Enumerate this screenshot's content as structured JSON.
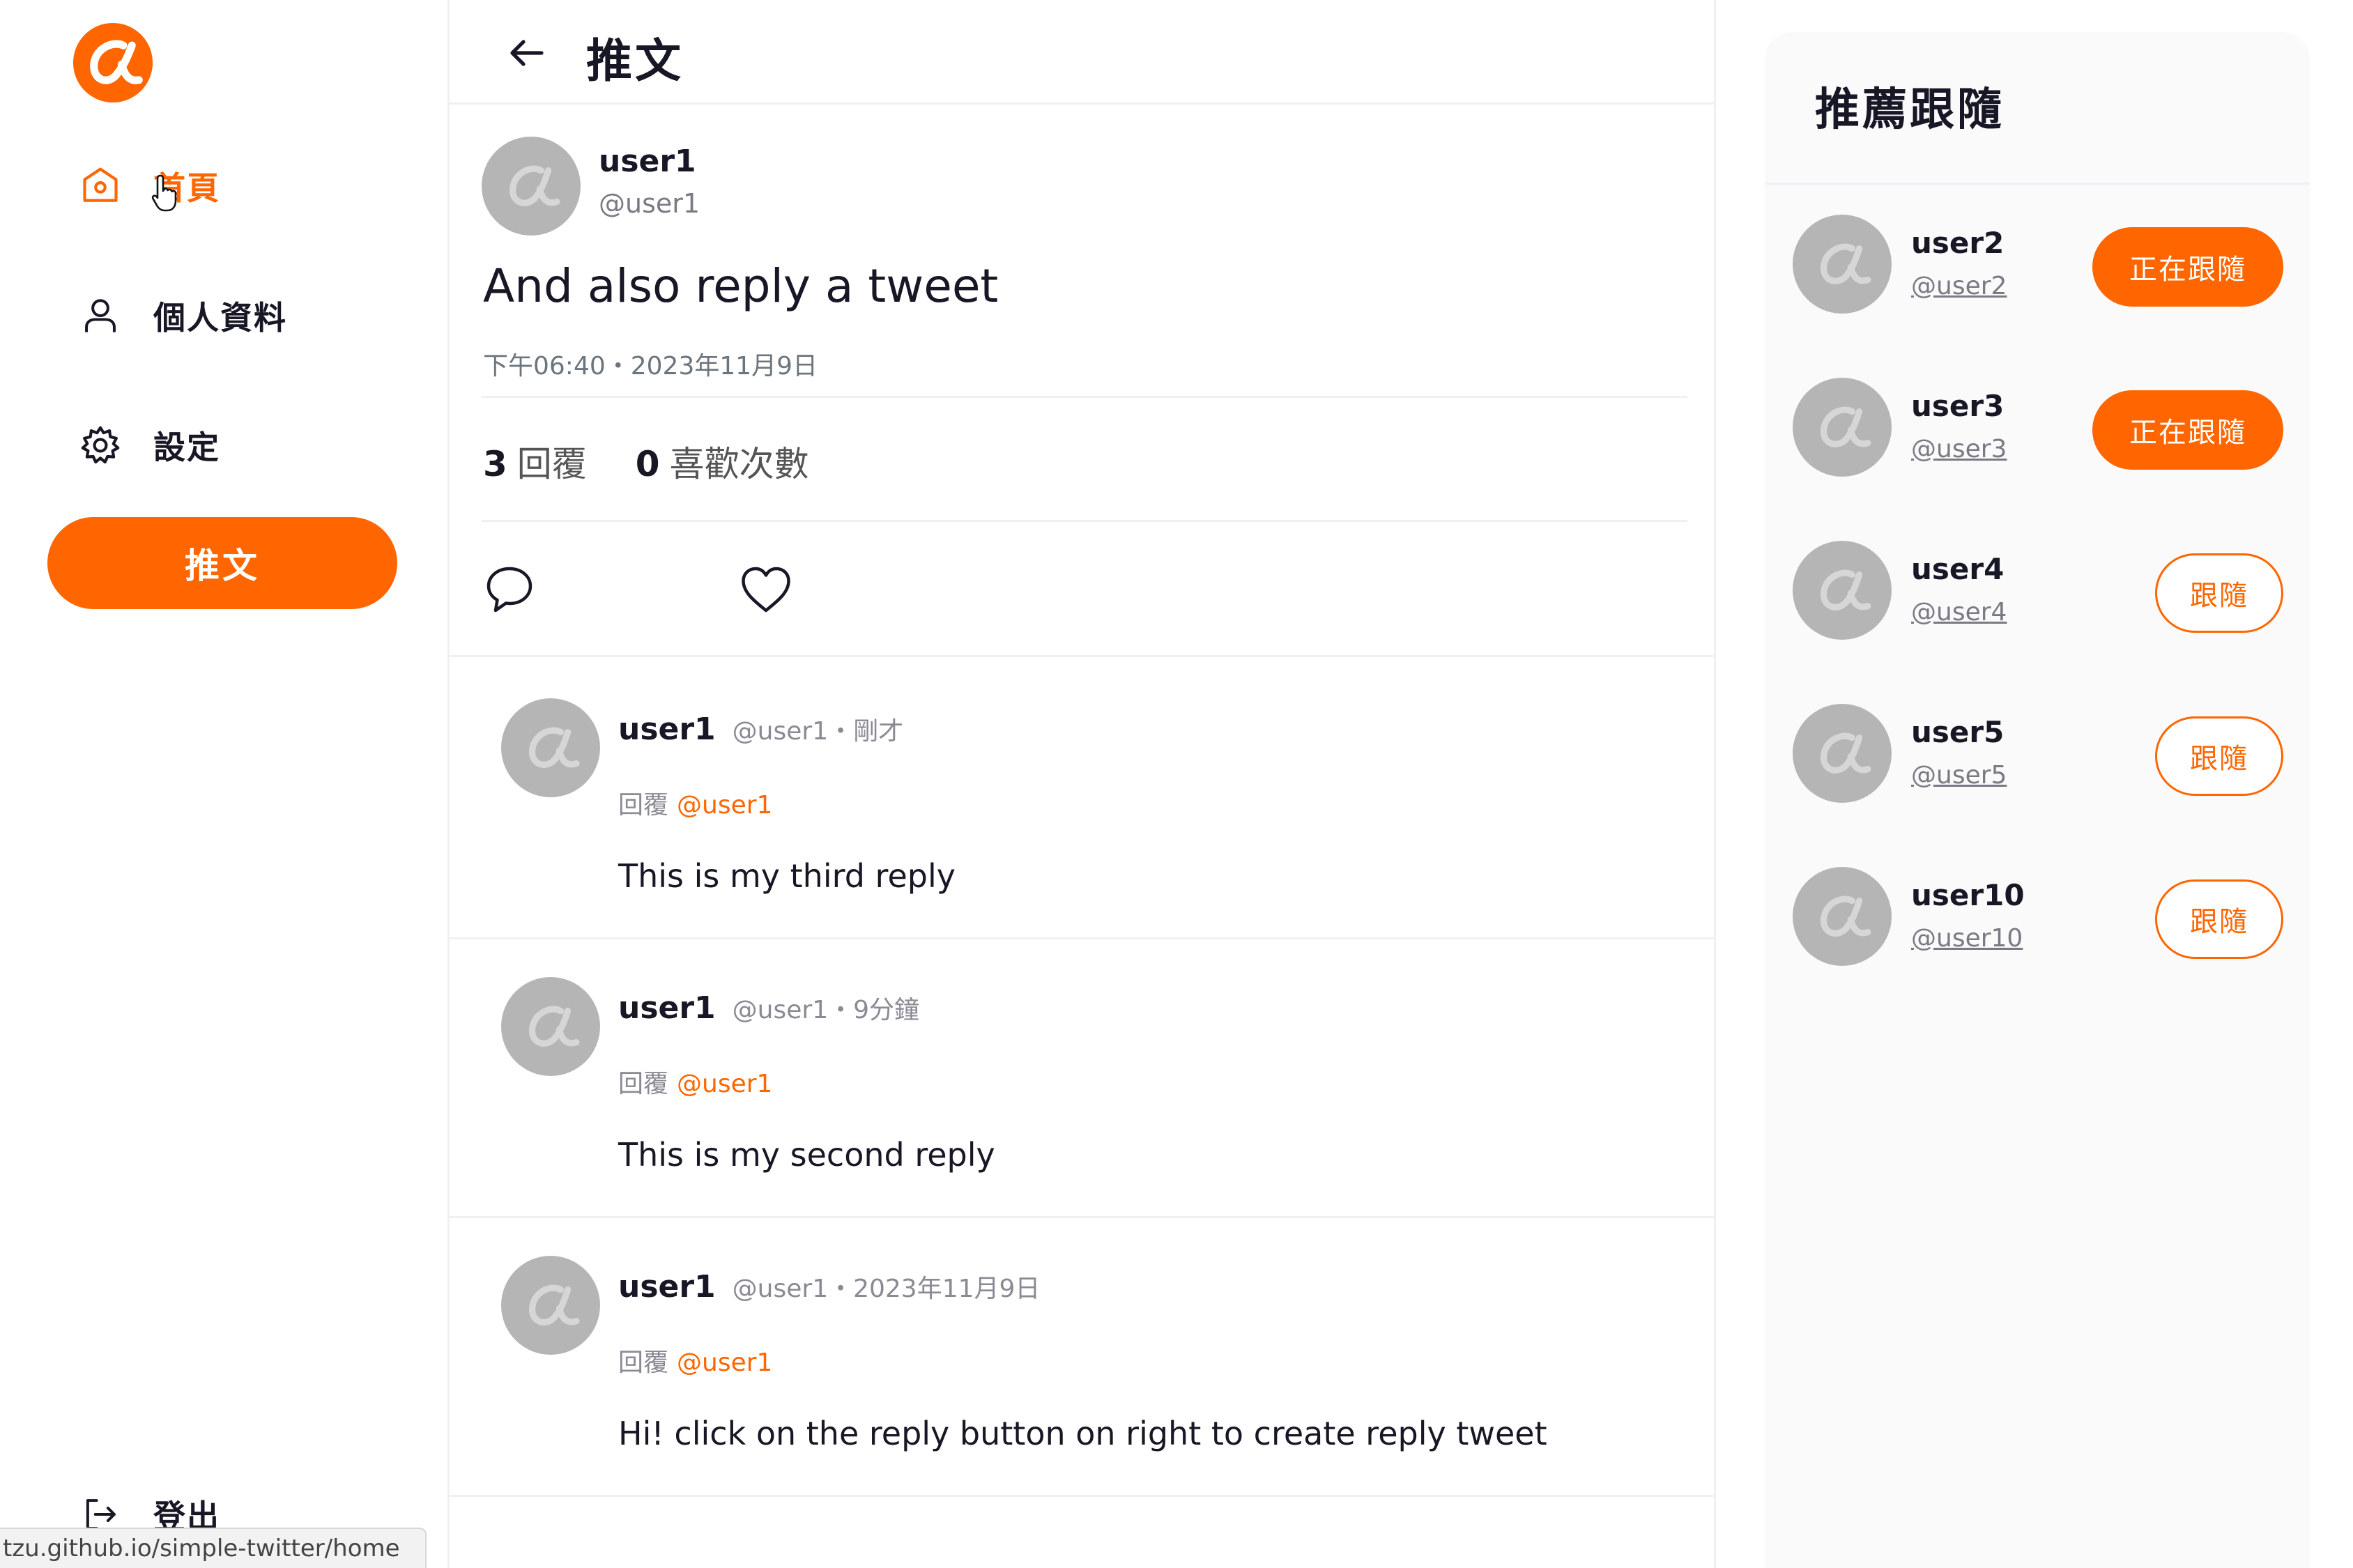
{
  "colors": {
    "brand": "#ff6600",
    "avatar_bg": "#b5b5b5",
    "text": "#171725",
    "muted": "#8a8a94"
  },
  "sidebar": {
    "items": [
      {
        "label": "首頁",
        "icon": "home-icon",
        "active": true
      },
      {
        "label": "個人資料",
        "icon": "user-icon",
        "active": false
      },
      {
        "label": "設定",
        "icon": "gear-icon",
        "active": false
      }
    ],
    "tweet_button": "推文",
    "logout_label": "登出"
  },
  "status_bar": {
    "url": "tzu.github.io/simple-twitter/home"
  },
  "header": {
    "title": "推文"
  },
  "tweet": {
    "name": "user1",
    "handle": "@user1",
    "content": "And also reply a tweet",
    "time": "下午06:40・2023年11月9日",
    "reply_count": "3",
    "reply_label": "回覆",
    "like_count": "0",
    "like_label": "喜歡次數"
  },
  "replies": [
    {
      "name": "user1",
      "meta": "@user1・剛才",
      "reply_to_label": "回覆",
      "reply_to": "@user1",
      "text": "This is my third reply"
    },
    {
      "name": "user1",
      "meta": "@user1・9分鐘",
      "reply_to_label": "回覆",
      "reply_to": "@user1",
      "text": "This is my second reply"
    },
    {
      "name": "user1",
      "meta": "@user1・2023年11月9日",
      "reply_to_label": "回覆",
      "reply_to": "@user1",
      "text": "Hi! click on the reply button on right to create reply tweet"
    }
  ],
  "suggestions": {
    "title": "推薦跟隨",
    "users": [
      {
        "name": "user2",
        "handle": "@user2",
        "button": "正在跟隨",
        "following": true
      },
      {
        "name": "user3",
        "handle": "@user3",
        "button": "正在跟隨",
        "following": true
      },
      {
        "name": "user4",
        "handle": "@user4",
        "button": "跟隨",
        "following": false
      },
      {
        "name": "user5",
        "handle": "@user5",
        "button": "跟隨",
        "following": false
      },
      {
        "name": "user10",
        "handle": "@user10",
        "button": "跟隨",
        "following": false
      }
    ]
  }
}
